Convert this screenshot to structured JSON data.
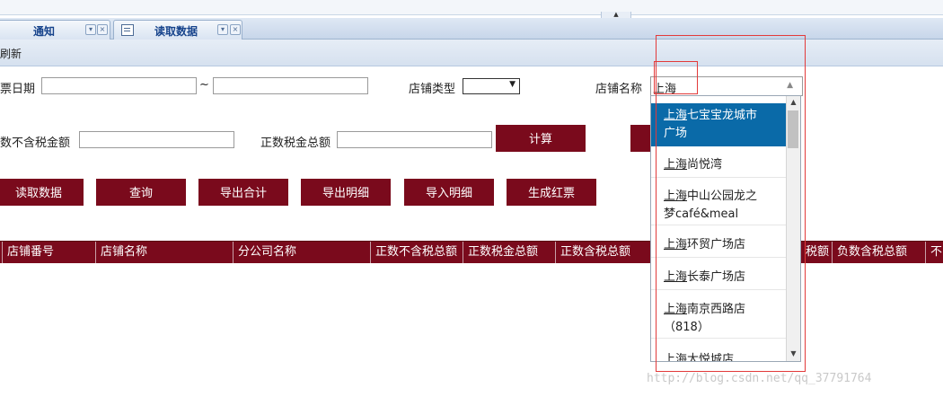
{
  "tabs": [
    {
      "label": "通知"
    },
    {
      "label": "读取数据"
    }
  ],
  "toolbar": {
    "refresh_label": "刷新"
  },
  "form": {
    "date_label": "票日期",
    "date_sep": "~",
    "date_start_value": "",
    "date_end_value": "",
    "store_type_label": "店铺类型",
    "store_type_value": "",
    "store_name_label": "店铺名称",
    "store_name_value": "上海",
    "net_amount_label": "数不含税金额",
    "net_amount_value": "",
    "tax_total_label": "正数税金总额",
    "tax_total_value": "",
    "calc_label": "计算"
  },
  "actions": [
    "读取数据",
    "查询",
    "导出合计",
    "导出明细",
    "导入明细",
    "生成红票"
  ],
  "grid": {
    "columns": [
      "店铺番号",
      "店铺名称",
      "分公司名称",
      "正数不含税总额",
      "正数税金总额",
      "正数含税总额",
      "税额",
      "负数含税总额",
      "不"
    ]
  },
  "dropdown": {
    "options": [
      {
        "prefix": "上海",
        "line1": "七宝宝龙城市",
        "line2": "广场",
        "selected": true
      },
      {
        "prefix": "上海",
        "line1": "尚悦湾",
        "line2": "",
        "selected": false
      },
      {
        "prefix": "上海",
        "line1": "中山公园龙之",
        "line2": "梦café&meal",
        "selected": false
      },
      {
        "prefix": "上海",
        "line1": "环贸广场店",
        "line2": "",
        "selected": false
      },
      {
        "prefix": "上海",
        "line1": "长泰广场店",
        "line2": "",
        "selected": false
      },
      {
        "prefix": "上海",
        "line1": "南京西路店",
        "line2": "（818）",
        "selected": false
      },
      {
        "prefix": "上海",
        "line1": "大悦城店",
        "line2": "",
        "selected": false
      }
    ]
  },
  "watermark": "http://blog.csdn.net/qq_37791764",
  "colors": {
    "accent": "#7a0a1c",
    "selected": "#0a6aa8",
    "annotation": "#e23a3a"
  }
}
